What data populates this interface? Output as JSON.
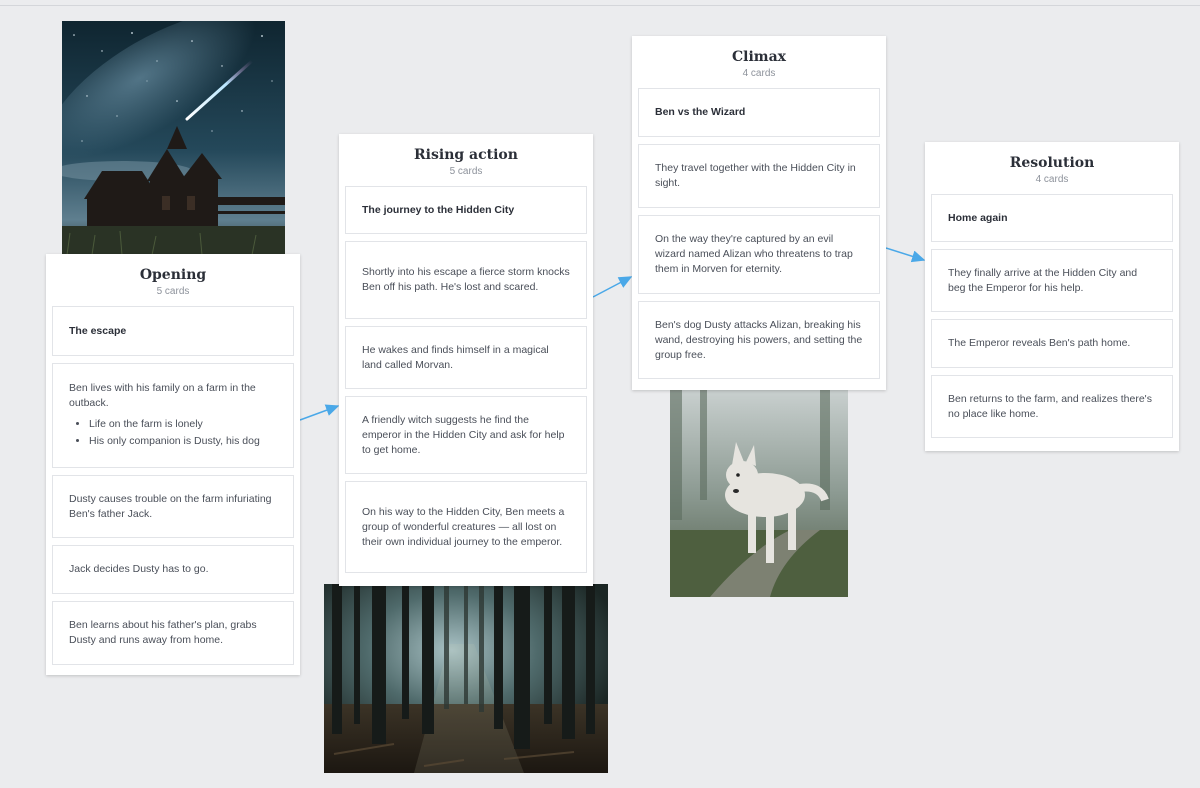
{
  "columns": [
    {
      "title": "Opening",
      "count": "5 cards",
      "cards": [
        {
          "text": "The escape"
        },
        {
          "text": "Ben lives with his family on a farm in the outback.",
          "bullets": [
            "Life on the farm is lonely",
            "His only companion is Dusty, his dog"
          ]
        },
        {
          "text": "Dusty causes trouble on the farm infuriating Ben's father Jack."
        },
        {
          "text": "Jack decides Dusty has to go."
        },
        {
          "text": "Ben learns about his father's plan, grabs Dusty and runs away from home."
        }
      ]
    },
    {
      "title": "Rising action",
      "count": "5 cards",
      "cards": [
        {
          "text": "The journey to the Hidden City"
        },
        {
          "text": "Shortly into his escape a fierce storm knocks Ben off his path. He's lost and scared."
        },
        {
          "text": "He wakes and finds himself in a magical land called Morvan."
        },
        {
          "text": "A friendly witch suggests he find the emperor in the Hidden City and ask for help to get home."
        },
        {
          "text": "On his way to the Hidden City, Ben meets a group of wonderful creatures — all lost on their own individual journey to the emperor."
        }
      ]
    },
    {
      "title": "Climax",
      "count": "4 cards",
      "cards": [
        {
          "text": "Ben vs the Wizard"
        },
        {
          "text": "They travel together with the Hidden City in sight."
        },
        {
          "text": "On the way they're captured by an evil wizard named Alizan who threatens to trap them in Morven for eternity."
        },
        {
          "text": "Ben's dog Dusty attacks Alizan, breaking his wand, destroying his powers, and setting the group free."
        }
      ]
    },
    {
      "title": "Resolution",
      "count": "4 cards",
      "cards": [
        {
          "text": "Home again"
        },
        {
          "text": "They finally arrive at the Hidden City and beg the Emperor for his help."
        },
        {
          "text": "The Emperor reveals Ben's path home."
        },
        {
          "text": "Ben returns to the farm, and realizes there's no place like home."
        }
      ]
    }
  ],
  "images": {
    "church": "night-sky-church-photo",
    "forest": "forest-photo",
    "wolf": "white-wolf-photo"
  },
  "colors": {
    "connector": "#4aa8e8",
    "canvas": "#ebecee"
  }
}
